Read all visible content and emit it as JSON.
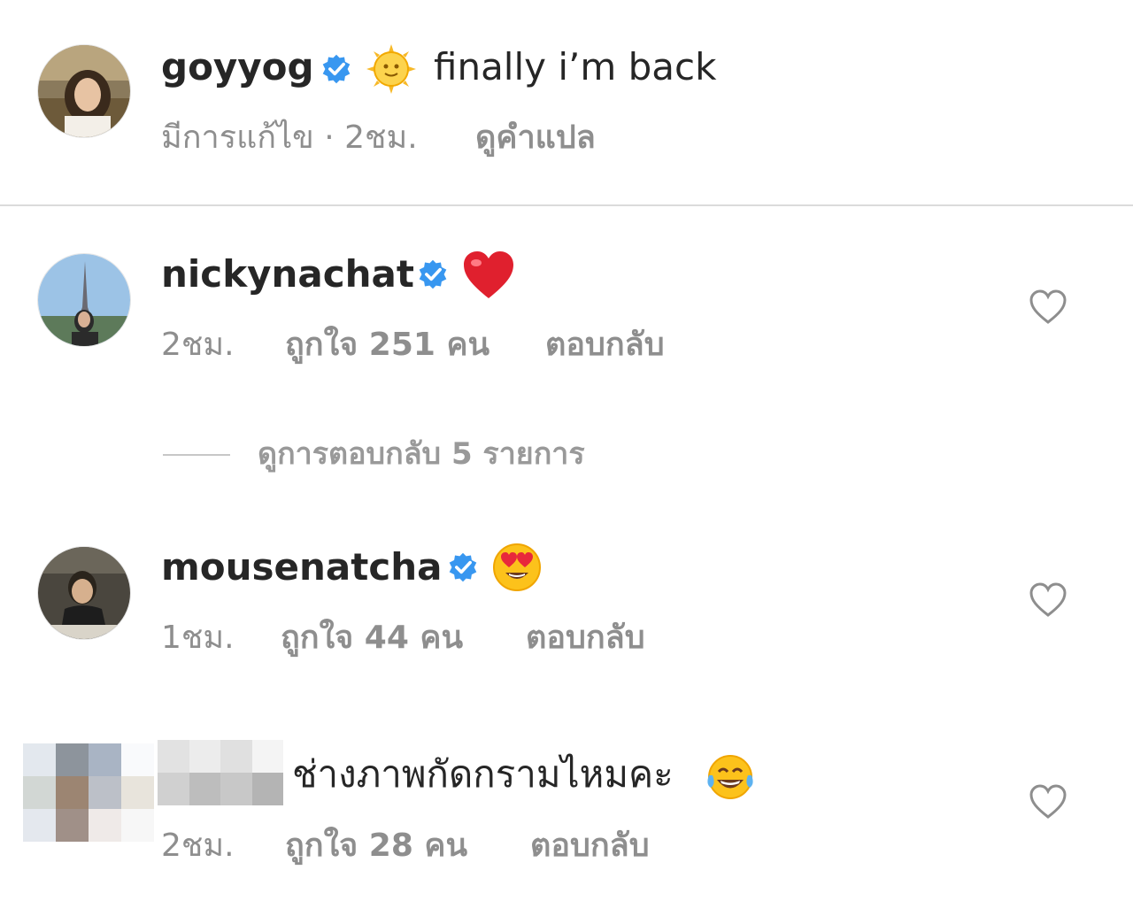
{
  "caption": {
    "username": "goyyog",
    "emoji": "sun-with-face-emoji",
    "text": "finally i’m back",
    "edited_time": "มีการแก้ไข · 2ชม.",
    "translate": "ดูคำแปล"
  },
  "comments": [
    {
      "username": "nickynachat",
      "emoji": "red-heart-emoji",
      "time": "2ชม.",
      "likes": "ถูกใจ 251 คน",
      "reply": "ตอบกลับ",
      "view_replies": "ดูการตอบกลับ 5 รายการ"
    },
    {
      "username": "mousenatcha",
      "emoji": "heart-eyes-emoji",
      "time": "1ชม.",
      "likes": "ถูกใจ 44 คน",
      "reply": "ตอบกลับ"
    },
    {
      "username": "",
      "text": "ช่างภาพกัดกรามไหมคะ",
      "emoji": "tears-of-joy-emoji",
      "time": "2ชม.",
      "likes": "ถูกใจ 28 คน",
      "reply": "ตอบกลับ"
    }
  ],
  "colors": {
    "verified_blue": "#3897f0",
    "secondary_text": "#8e8e8e",
    "primary_text": "#262626",
    "divider": "#dbdbdb"
  }
}
